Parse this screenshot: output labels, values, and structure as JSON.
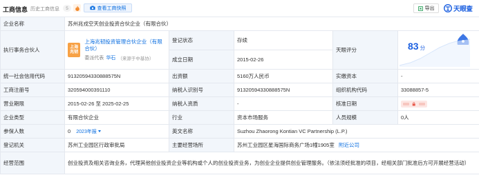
{
  "header": {
    "title": "工商信息",
    "history_label": "历史工商信息",
    "history_count": "5",
    "snapshot_label": "查看工商快照",
    "export_label": "导出",
    "logo_text": "天眼查",
    "accent_color": "#0c6fe0"
  },
  "info": {
    "company_name_label": "企业名称",
    "company_name": "苏州兆戎空天创业投资合伙企业（有限合伙）",
    "partner_label": "执行事务合伙人",
    "partner_logo_text_1": "上海",
    "partner_logo_text_2": "兆韧",
    "partner_name": "上海兆韧投资管理合伙企业（有限合伙）",
    "representative_label": "委派代表",
    "representative_name": "华石",
    "representative_source": "（来源于中基协）",
    "reg_status_label": "登记状态",
    "reg_status": "存续",
    "founded_label": "成立日期",
    "founded": "2015-02-26",
    "score_label": "天眼评分",
    "score_value": "83",
    "score_unit": "分",
    "credit_code_label": "统一社会信用代码",
    "credit_code": "91320594330888575N",
    "capital_label": "出资额",
    "capital": "5160万人民币",
    "paid_capital_label": "实缴资本",
    "paid_capital": "-",
    "reg_no_label": "工商注册号",
    "reg_no": "320594000391110",
    "taxpayer_id_label": "纳税人识别号",
    "taxpayer_id": "91320594330888575N",
    "org_code_label": "组织机构代码",
    "org_code": "33088857-5",
    "term_label": "营业期限",
    "term": "2015-02-26 至 2025-02-25",
    "taxpayer_quality_label": "纳税人资质",
    "taxpayer_quality": "-",
    "approval_date_label": "核准日期",
    "company_type_label": "企业类型",
    "company_type": "有限合伙企业",
    "industry_label": "行业",
    "industry": "资本市场服务",
    "staff_size_label": "人员规模",
    "staff_size": "0人",
    "insured_label": "参保人数",
    "insured": "0",
    "insured_year": "2023年报",
    "english_name_label": "英文名称",
    "english_name": "Suzhou Zhaorong Kontian VC Partnership (L.P.)",
    "authority_label": "登记机关",
    "authority": "苏州工业园区行政审批局",
    "address_label": "主要经营场所",
    "address": "苏州工业园区星海国际商务广场1幢1905室",
    "nearby_label": "附近公司",
    "scope_label": "经营范围",
    "scope": "创业投资及相关咨询业务，代理其他创业投资企业等机构或个人的创业投资业务，为创业企业提供创业管理服务。（依法须经批准的项目，经相关部门批准后方可开展经营活动）"
  }
}
